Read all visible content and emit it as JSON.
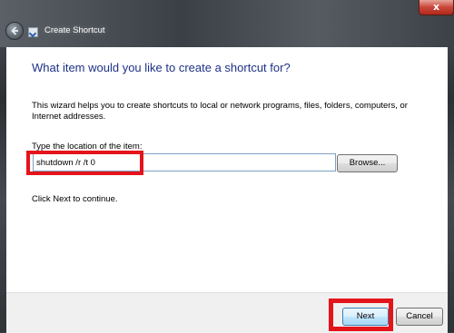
{
  "window": {
    "title": "Create Shortcut",
    "close_symbol": "x",
    "icons": {
      "back": "back-arrow-icon",
      "app": "shortcut-icon",
      "close": "close-icon"
    }
  },
  "wizard": {
    "heading": "What item would you like to create a shortcut for?",
    "description": "This wizard helps you to create shortcuts to local or network programs, files, folders, computers, or Internet addresses.",
    "location_label": "Type the location of the item:",
    "location_value": "shutdown /r /t 0",
    "browse_label": "Browse...",
    "continue_text": "Click Next to continue."
  },
  "footer": {
    "next_label": "Next",
    "cancel_label": "Cancel"
  },
  "colors": {
    "heading": "#1e3287",
    "highlight": "#e4141b",
    "close_button": "#c9473a"
  }
}
